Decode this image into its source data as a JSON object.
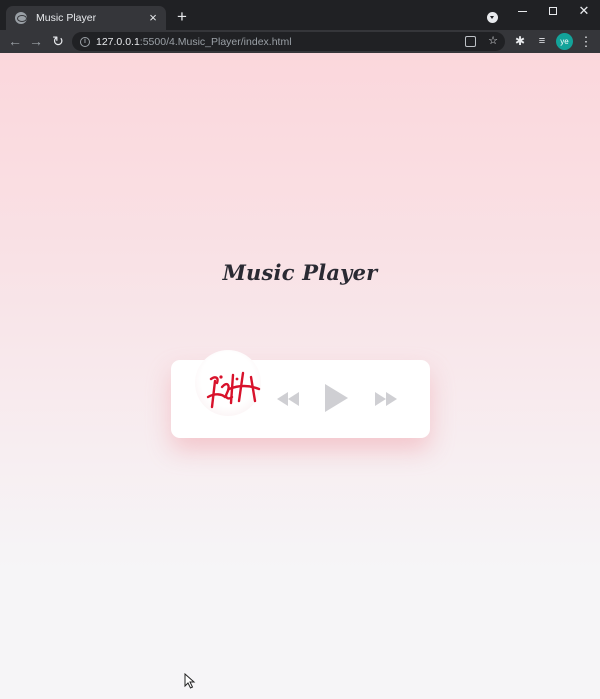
{
  "browser": {
    "tab_title": "Music Player",
    "tab_close": "×",
    "new_tab": "+",
    "url_host": "127.0.0.1",
    "url_path": ":5500/4.Music_Player/index.html",
    "info_glyph": "i",
    "avatar_initials": "ye",
    "avatar_color": "#13a39a",
    "icons": {
      "back": "←",
      "forward": "→",
      "reload": "↻",
      "star": "☆",
      "extensions": "✱",
      "reading_list": "≡",
      "menu": "⋮",
      "close": "✕"
    }
  },
  "page": {
    "title": "Music Player",
    "colors": {
      "background_top": "#fbd7dc",
      "background_bottom": "#f6f5f7",
      "card": "#ffffff",
      "title": "#2a2a33",
      "controls": "#cfcfd3",
      "album_art_accent": "#d8122b"
    }
  }
}
